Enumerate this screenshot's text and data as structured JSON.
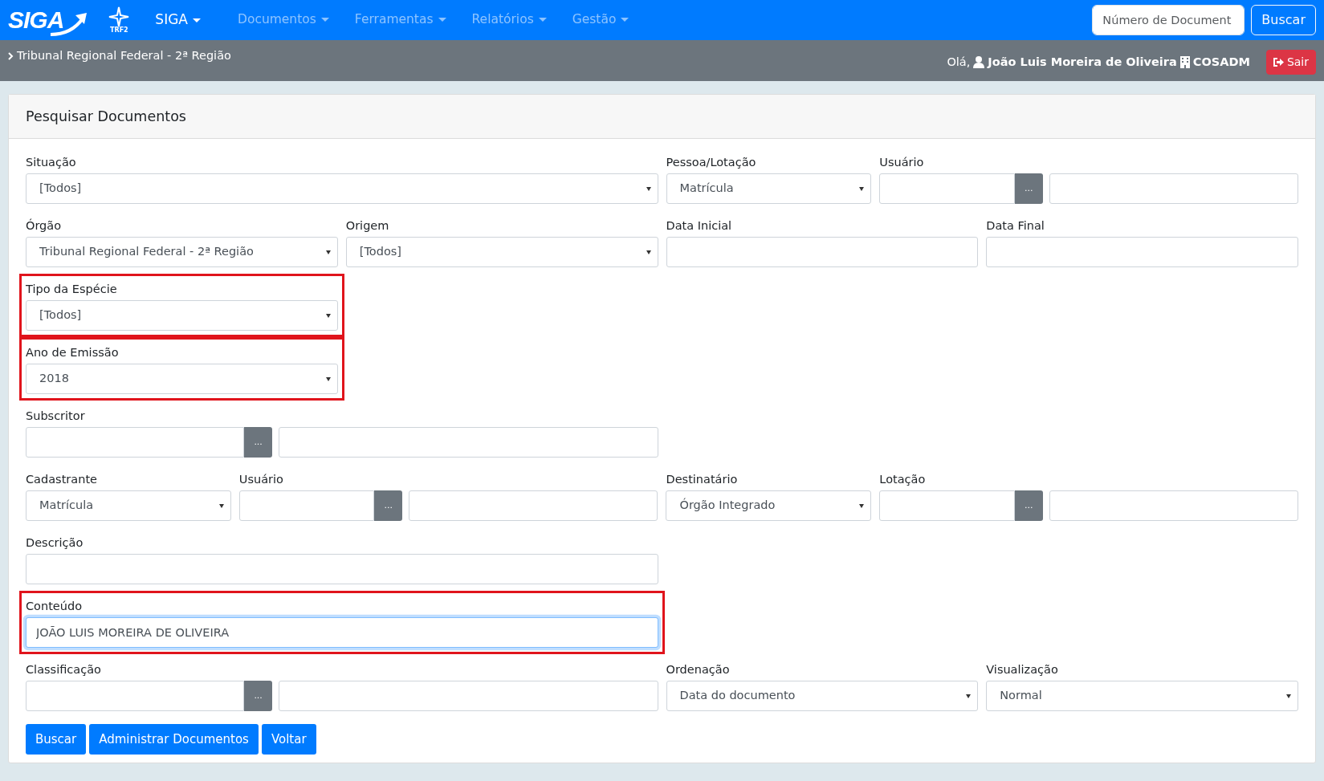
{
  "navbar": {
    "logo": "SIGA",
    "logo_sub": "TRF2",
    "menus": [
      {
        "label": "SIGA",
        "active": true
      },
      {
        "label": "Documentos",
        "active": false
      },
      {
        "label": "Ferramentas",
        "active": false
      },
      {
        "label": "Relatórios",
        "active": false
      },
      {
        "label": "Gestão",
        "active": false
      }
    ],
    "search": {
      "placeholder": "Número de Document"
    },
    "search_button": "Buscar"
  },
  "subbar": {
    "breadcrumb": "Tribunal Regional Federal - 2ª Região",
    "greeting": "Olá,",
    "user": "João Luis Moreira de Oliveira",
    "unit": "COSADM",
    "logout": "Sair"
  },
  "card": {
    "title": "Pesquisar Documentos",
    "rows": [
      [
        {
          "kind": "select",
          "label": "Situação",
          "value": "[Todos]"
        },
        {
          "kind": "select",
          "label": "Pessoa/Lotação",
          "value": "Matrícula"
        },
        {
          "kind": "lookup",
          "label": "Usuário",
          "button": "..."
        }
      ],
      [
        {
          "kind": "select",
          "label": "Órgão",
          "value": "Tribunal Regional Federal - 2ª Região"
        },
        {
          "kind": "select",
          "label": "Origem",
          "value": "[Todos]"
        },
        {
          "kind": "input",
          "label": "Data Inicial"
        },
        {
          "kind": "input",
          "label": "Data Final"
        }
      ],
      [
        {
          "kind": "select",
          "label": "Tipo da Espécie",
          "value": "[Todos]",
          "highlighted": true
        }
      ],
      [
        {
          "kind": "select",
          "label": "Ano de Emissão",
          "value": "2018",
          "highlighted": true
        }
      ],
      [
        {
          "kind": "lookup",
          "label": "Subscritor",
          "button": "..."
        }
      ],
      [
        {
          "kind": "select",
          "label": "Cadastrante",
          "value": "Matrícula"
        },
        {
          "kind": "lookup",
          "label": "Usuário",
          "button": "..."
        },
        {
          "kind": "select",
          "label": "Destinatário",
          "value": "Órgão Integrado"
        },
        {
          "kind": "lookup",
          "label": "Lotação",
          "button": "..."
        }
      ],
      [
        {
          "kind": "input",
          "label": "Descrição"
        }
      ],
      [
        {
          "kind": "input",
          "label": "Conteúdo",
          "value": "JOÃO LUIS MOREIRA DE OLIVEIRA",
          "highlighted": true,
          "focused": true
        }
      ],
      [
        {
          "kind": "lookup",
          "label": "Classificação",
          "button": "..."
        },
        {
          "kind": "select",
          "label": "Ordenação",
          "value": "Data do documento"
        },
        {
          "kind": "select",
          "label": "Visualização",
          "value": "Normal"
        }
      ]
    ],
    "buttons": [
      "Buscar",
      "Administrar Documentos",
      "Voltar"
    ]
  }
}
